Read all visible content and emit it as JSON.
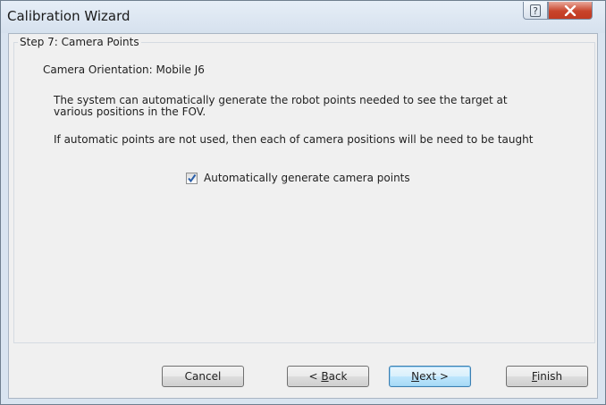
{
  "window": {
    "title": "Calibration Wizard",
    "help_icon": "question-icon",
    "close_icon": "close-icon"
  },
  "step": {
    "label": "Step 7: Camera Points",
    "orientation": "Camera Orientation: Mobile J6",
    "description_line1": "The system can automatically generate the robot points needed to see the target at",
    "description_line2": "various positions in the FOV.",
    "note": "If automatic points are not used, then each of camera positions will be need to be taught"
  },
  "auto_points": {
    "label": "Automatically generate camera points",
    "checked": true
  },
  "buttons": {
    "cancel": "Cancel",
    "back_prefix": "< ",
    "back_key": "B",
    "back_rest": "ack",
    "next_key": "N",
    "next_rest": "ext >",
    "finish_key": "F",
    "finish_rest": "inish"
  },
  "colors": {
    "close_button": "#c8442b",
    "checkmark": "#2a5ea8",
    "default_button_border": "#3c7fb1"
  }
}
